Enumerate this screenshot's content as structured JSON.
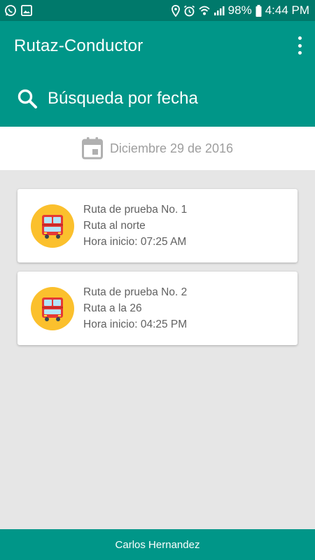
{
  "status_bar": {
    "battery": "98%",
    "time": "4:44 PM",
    "icons": [
      "whatsapp-icon",
      "image-icon",
      "location-icon",
      "alarm-icon",
      "wifi-icon",
      "signal-icon",
      "battery-icon"
    ]
  },
  "app_bar": {
    "title": "Rutaz-Conductor",
    "search_label": "Búsqueda por fecha"
  },
  "date_selector": {
    "date": "Diciembre 29 de 2016"
  },
  "routes": [
    {
      "name": "Ruta de prueba No. 1",
      "description": "Ruta al norte",
      "start": "Hora inicio: 07:25 AM"
    },
    {
      "name": "Ruta de prueba No. 2",
      "description": "Ruta a la 26",
      "start": "Hora inicio: 04:25 PM"
    }
  ],
  "footer": {
    "user": "Carlos Hernandez"
  },
  "colors": {
    "primary": "#009688",
    "primary_dark": "#00796b",
    "accent": "#fbc02d",
    "background": "#e6e6e6"
  }
}
